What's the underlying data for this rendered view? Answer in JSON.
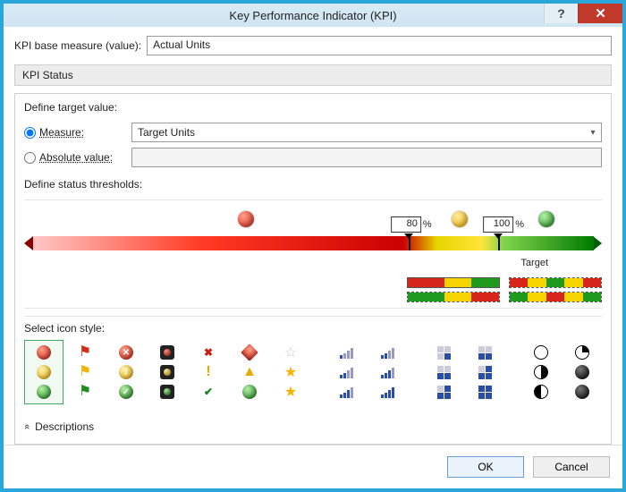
{
  "title": "Key Performance Indicator (KPI)",
  "titlebar": {
    "help_glyph": "?",
    "close_glyph": "✕"
  },
  "base": {
    "label": "KPI base measure (value):",
    "value": "Actual Units"
  },
  "section_header": "KPI Status",
  "target": {
    "heading": "Define target value:",
    "measure_label": "Measure:",
    "measure_value": "Target Units",
    "absolute_label": "Absolute value:",
    "absolute_value": ""
  },
  "thresholds": {
    "heading": "Define status thresholds:",
    "value1": "80",
    "value2": "100",
    "percent": "%",
    "target_label": "Target"
  },
  "icon_section": {
    "heading": "Select icon style:"
  },
  "descriptions_label": "Descriptions",
  "buttons": {
    "ok": "OK",
    "cancel": "Cancel"
  }
}
